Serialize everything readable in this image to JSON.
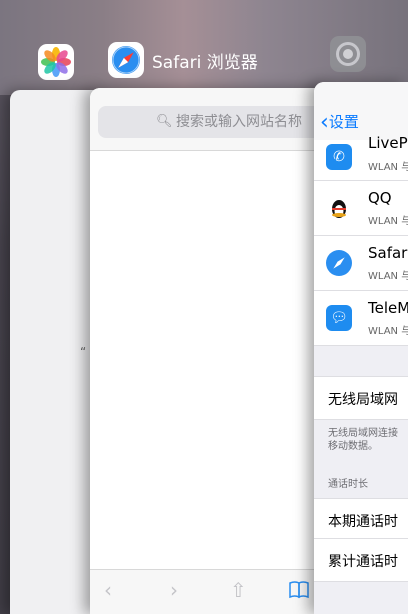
{
  "switcher": {
    "photos_app": {
      "icon": "photos-icon"
    },
    "safari_app": {
      "icon": "safari-compass-icon",
      "title": "Safari 浏览器"
    },
    "settings_app": {
      "icon": "gear-icon"
    }
  },
  "safari": {
    "search_placeholder": "搜索或输入网站名称",
    "toolbar": {
      "back": "‹",
      "forward": "›",
      "share": "⇧",
      "bookmarks": "📖"
    }
  },
  "settings": {
    "back_label": "设置",
    "apps": [
      {
        "name": "LiveP",
        "sub": "WLAN 与",
        "icon": "phone-icon",
        "color": "#1e8cf0"
      },
      {
        "name": "QQ",
        "sub": "WLAN 与",
        "icon": "penguin-icon",
        "color": "#ffffff"
      },
      {
        "name": "Safari",
        "sub": "WLAN 与",
        "icon": "safari-compass-icon",
        "color": "#2a8ef0"
      },
      {
        "name": "TeleM",
        "sub": "WLAN 与",
        "icon": "telem-chat-icon",
        "color": "#1e8cf0"
      }
    ],
    "wlan_row": "无线局域网",
    "wlan_note_1": "无线局域网连接",
    "wlan_note_2": "移动数据。",
    "call_section": "通话时长",
    "this_period": "本期通话时",
    "total": "累计通话时"
  },
  "photos_card": {
    "tick_mark": "“"
  }
}
